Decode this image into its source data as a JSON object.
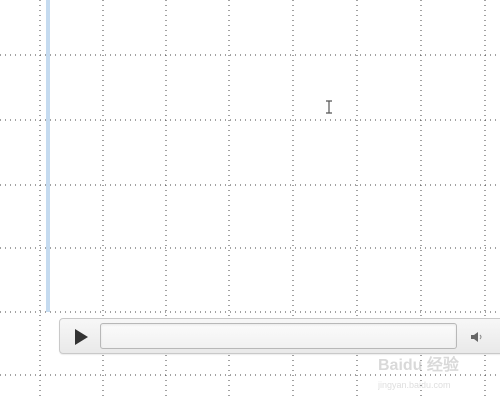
{
  "player": {
    "progress": 0,
    "play_icon": "play-icon",
    "volume_icon": "speaker-icon"
  },
  "watermark": {
    "text": "Baidu 经验",
    "subtext": "jingyan.baidu.com"
  }
}
